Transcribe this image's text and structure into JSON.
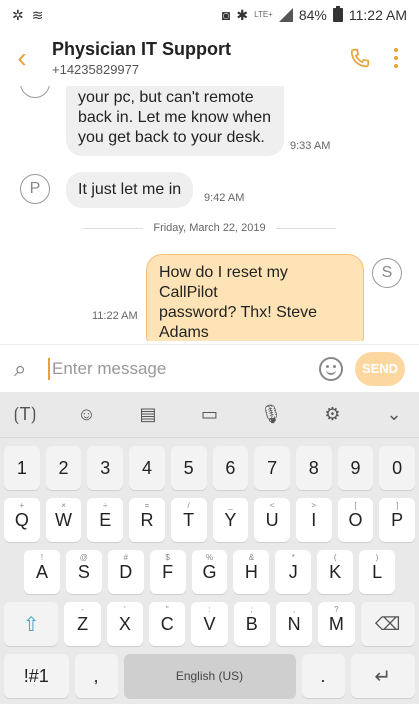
{
  "status": {
    "battery": "84%",
    "time": "11:22 AM",
    "network": "LTE+"
  },
  "header": {
    "title": "Physician IT Support",
    "phone": "+14235829977"
  },
  "messages": [
    {
      "dir": "in",
      "lines": [
        "your pc, but can't remote",
        "back in. Let me know when",
        "you get back to your desk."
      ],
      "time": "9:33 AM"
    },
    {
      "dir": "in",
      "avatar": "P",
      "text": "It just let me in",
      "time": "9:42 AM"
    },
    {
      "dir": "out",
      "avatar": "S",
      "lines": [
        "How do I reset my CallPilot",
        "password? Thx! Steve",
        "Adams"
      ],
      "time": "11:22 AM"
    }
  ],
  "date_separator": "Friday, March 22, 2019",
  "input": {
    "placeholder": "Enter message",
    "send_label": "SEND"
  },
  "keyboard": {
    "number_row": [
      "1",
      "2",
      "3",
      "4",
      "5",
      "6",
      "7",
      "8",
      "9",
      "0"
    ],
    "row1": [
      {
        "k": "Q",
        "s": "+"
      },
      {
        "k": "W",
        "s": "×"
      },
      {
        "k": "E",
        "s": "÷"
      },
      {
        "k": "R",
        "s": "="
      },
      {
        "k": "T",
        "s": "/"
      },
      {
        "k": "Y",
        "s": "_"
      },
      {
        "k": "U",
        "s": "<"
      },
      {
        "k": "I",
        "s": ">"
      },
      {
        "k": "O",
        "s": "["
      },
      {
        "k": "P",
        "s": "]"
      }
    ],
    "row2": [
      {
        "k": "A",
        "s": "!"
      },
      {
        "k": "S",
        "s": "@"
      },
      {
        "k": "D",
        "s": "#"
      },
      {
        "k": "F",
        "s": "$"
      },
      {
        "k": "G",
        "s": "%"
      },
      {
        "k": "H",
        "s": "&"
      },
      {
        "k": "J",
        "s": "*"
      },
      {
        "k": "K",
        "s": "("
      },
      {
        "k": "L",
        "s": ")"
      }
    ],
    "row3": [
      {
        "k": "Z",
        "s": "-"
      },
      {
        "k": "X",
        "s": "'"
      },
      {
        "k": "C",
        "s": "\""
      },
      {
        "k": "V",
        "s": ":"
      },
      {
        "k": "B",
        "s": ";"
      },
      {
        "k": "N",
        "s": ","
      },
      {
        "k": "M",
        "s": "?"
      }
    ],
    "sym_label": "!#1",
    "comma": ",",
    "space_label": "English (US)",
    "period": "."
  },
  "colors": {
    "accent": "#e7a23d",
    "out_bubble": "#fde3b6",
    "in_bubble": "#efefef"
  }
}
